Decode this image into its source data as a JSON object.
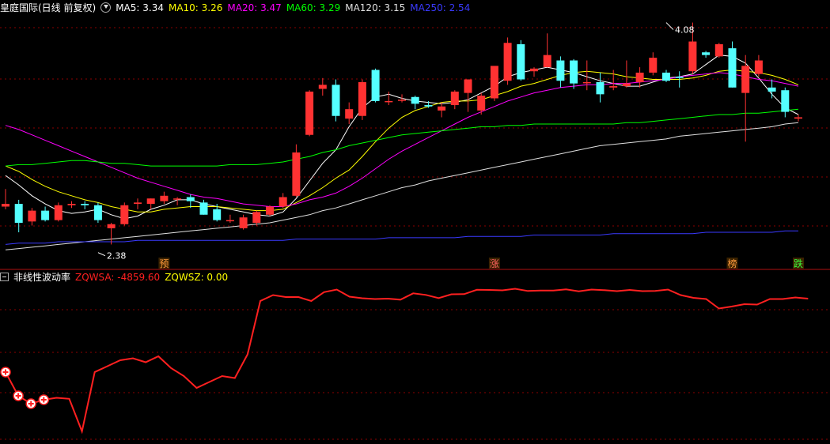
{
  "header": {
    "title": "皇庭国际(日线 前复权)",
    "ma": [
      {
        "label": "MA5: 3.34",
        "color": "#ffffff"
      },
      {
        "label": "MA10: 3.26",
        "color": "#ffff00"
      },
      {
        "label": "MA20: 3.47",
        "color": "#ff00ff"
      },
      {
        "label": "MA60: 3.29",
        "color": "#00ff00"
      },
      {
        "label": "MA120: 3.15",
        "color": "#e0e0e0"
      },
      {
        "label": "MA250: 2.54",
        "color": "#3a3aff"
      }
    ]
  },
  "indicator_header": {
    "name": "非线性波动率",
    "items": [
      {
        "label": "ZQWSA: -4859.60",
        "color": "#ff2020"
      },
      {
        "label": "ZQWSZ: 0.00",
        "color": "#ffff00"
      }
    ]
  },
  "colors": {
    "up": "#ff3232",
    "down": "#54ffff",
    "grid": "#8b0000",
    "bg": "#000000"
  },
  "chart_data": [
    {
      "type": "candlestick",
      "ylim": [
        2.32,
        4.13
      ],
      "grid": true,
      "annotations": [
        {
          "text": "4.08",
          "x": 50,
          "value": 4.08
        },
        {
          "text": "2.38",
          "x": 7,
          "value": 2.38
        }
      ],
      "event_markers": [
        {
          "text": "预",
          "x": 12,
          "color": "#ff9a3c"
        },
        {
          "text": "涨",
          "x": 37,
          "color": "#ff6060"
        },
        {
          "text": "榜",
          "x": 55,
          "color": "#ff9a3c"
        },
        {
          "text": "跌",
          "x": 60,
          "color": "#3cff3c"
        }
      ],
      "ohlc": [
        [
          2.72,
          2.85,
          2.7,
          2.74
        ],
        [
          2.74,
          2.77,
          2.53,
          2.6
        ],
        [
          2.61,
          2.71,
          2.58,
          2.69
        ],
        [
          2.69,
          2.72,
          2.61,
          2.62
        ],
        [
          2.62,
          2.75,
          2.61,
          2.73
        ],
        [
          2.73,
          2.76,
          2.71,
          2.74
        ],
        [
          2.74,
          2.76,
          2.7,
          2.73
        ],
        [
          2.73,
          2.75,
          2.6,
          2.62
        ],
        [
          2.56,
          2.6,
          2.44,
          2.59
        ],
        [
          2.59,
          2.75,
          2.58,
          2.73
        ],
        [
          2.74,
          2.78,
          2.7,
          2.75
        ],
        [
          2.74,
          2.78,
          2.7,
          2.78
        ],
        [
          2.76,
          2.83,
          2.74,
          2.8
        ],
        [
          2.78,
          2.79,
          2.73,
          2.78
        ],
        [
          2.79,
          2.81,
          2.71,
          2.76
        ],
        [
          2.75,
          2.77,
          2.66,
          2.66
        ],
        [
          2.7,
          2.74,
          2.61,
          2.62
        ],
        [
          2.62,
          2.66,
          2.6,
          2.62
        ],
        [
          2.56,
          2.66,
          2.55,
          2.64
        ],
        [
          2.6,
          2.69,
          2.58,
          2.68
        ],
        [
          2.66,
          2.73,
          2.65,
          2.72
        ],
        [
          2.72,
          2.82,
          2.71,
          2.79
        ],
        [
          2.8,
          3.18,
          2.79,
          3.12
        ],
        [
          3.25,
          3.58,
          3.24,
          3.57
        ],
        [
          3.59,
          3.67,
          3.54,
          3.62
        ],
        [
          3.62,
          3.66,
          3.35,
          3.39
        ],
        [
          3.37,
          3.49,
          3.33,
          3.44
        ],
        [
          3.39,
          3.66,
          3.36,
          3.64
        ],
        [
          3.73,
          3.74,
          3.49,
          3.5
        ],
        [
          3.5,
          3.57,
          3.47,
          3.5
        ],
        [
          3.51,
          3.55,
          3.49,
          3.51
        ],
        [
          3.53,
          3.54,
          3.44,
          3.48
        ],
        [
          3.47,
          3.5,
          3.45,
          3.46
        ],
        [
          3.43,
          3.49,
          3.38,
          3.46
        ],
        [
          3.47,
          3.58,
          3.44,
          3.57
        ],
        [
          3.56,
          3.65,
          3.42,
          3.66
        ],
        [
          3.43,
          3.56,
          3.4,
          3.54
        ],
        [
          3.52,
          3.74,
          3.5,
          3.76
        ],
        [
          3.65,
          3.97,
          3.62,
          3.93
        ],
        [
          3.92,
          3.95,
          3.65,
          3.66
        ],
        [
          3.72,
          3.75,
          3.68,
          3.74
        ],
        [
          3.75,
          4.0,
          3.75,
          3.84
        ],
        [
          3.8,
          3.83,
          3.6,
          3.65
        ],
        [
          3.8,
          3.81,
          3.59,
          3.63
        ],
        [
          3.64,
          3.8,
          3.58,
          3.64
        ],
        [
          3.64,
          3.71,
          3.49,
          3.55
        ],
        [
          3.6,
          3.73,
          3.58,
          3.61
        ],
        [
          3.61,
          3.8,
          3.6,
          3.63
        ],
        [
          3.64,
          3.75,
          3.6,
          3.71
        ],
        [
          3.71,
          3.86,
          3.69,
          3.82
        ],
        [
          3.71,
          3.73,
          3.64,
          3.65
        ],
        [
          3.68,
          3.72,
          3.6,
          3.67
        ],
        [
          3.72,
          4.08,
          3.7,
          3.94
        ],
        [
          3.86,
          3.87,
          3.82,
          3.84
        ],
        [
          3.83,
          3.93,
          3.82,
          3.92
        ],
        [
          3.89,
          3.94,
          3.6,
          3.6
        ],
        [
          3.56,
          3.84,
          3.2,
          3.76
        ],
        [
          3.7,
          3.84,
          3.68,
          3.8
        ],
        [
          3.6,
          3.66,
          3.52,
          3.57
        ],
        [
          3.58,
          3.6,
          3.38,
          3.42
        ],
        [
          3.37,
          3.4,
          3.35,
          3.38
        ]
      ],
      "ma_lines": {
        "MA5": [
          2.95,
          2.88,
          2.8,
          2.74,
          2.69,
          2.67,
          2.68,
          2.7,
          2.66,
          2.63,
          2.65,
          2.7,
          2.73,
          2.77,
          2.77,
          2.74,
          2.72,
          2.7,
          2.68,
          2.66,
          2.65,
          2.68,
          2.78,
          2.91,
          3.04,
          3.14,
          3.31,
          3.45,
          3.53,
          3.55,
          3.52,
          3.5,
          3.49,
          3.48,
          3.49,
          3.51,
          3.56,
          3.61,
          3.68,
          3.71,
          3.73,
          3.75,
          3.73,
          3.71,
          3.68,
          3.65,
          3.63,
          3.61,
          3.61,
          3.64,
          3.67,
          3.68,
          3.7,
          3.77,
          3.84,
          3.83,
          3.78,
          3.67,
          3.55,
          3.45,
          3.4
        ],
        "MA10": [
          3.02,
          2.98,
          2.92,
          2.87,
          2.83,
          2.8,
          2.77,
          2.75,
          2.72,
          2.7,
          2.68,
          2.68,
          2.7,
          2.71,
          2.72,
          2.72,
          2.72,
          2.71,
          2.7,
          2.69,
          2.69,
          2.7,
          2.75,
          2.8,
          2.86,
          2.93,
          2.99,
          3.09,
          3.2,
          3.3,
          3.38,
          3.43,
          3.46,
          3.49,
          3.5,
          3.5,
          3.51,
          3.54,
          3.57,
          3.61,
          3.63,
          3.66,
          3.69,
          3.71,
          3.72,
          3.71,
          3.7,
          3.68,
          3.67,
          3.66,
          3.66,
          3.66,
          3.67,
          3.69,
          3.72,
          3.73,
          3.72,
          3.71,
          3.69,
          3.66,
          3.62
        ],
        "MA20": [
          3.32,
          3.29,
          3.25,
          3.21,
          3.17,
          3.13,
          3.09,
          3.05,
          3.01,
          2.97,
          2.93,
          2.9,
          2.87,
          2.84,
          2.81,
          2.79,
          2.78,
          2.76,
          2.74,
          2.73,
          2.72,
          2.72,
          2.74,
          2.77,
          2.79,
          2.82,
          2.87,
          2.93,
          3.0,
          3.07,
          3.13,
          3.18,
          3.23,
          3.28,
          3.33,
          3.38,
          3.42,
          3.46,
          3.5,
          3.53,
          3.56,
          3.58,
          3.6,
          3.61,
          3.62,
          3.62,
          3.63,
          3.63,
          3.64,
          3.65,
          3.66,
          3.68,
          3.69,
          3.7,
          3.71,
          3.7,
          3.68,
          3.66,
          3.65,
          3.63,
          3.61
        ],
        "MA60": [
          3.02,
          3.03,
          3.03,
          3.04,
          3.05,
          3.06,
          3.06,
          3.05,
          3.04,
          3.04,
          3.03,
          3.02,
          3.02,
          3.02,
          3.02,
          3.02,
          3.02,
          3.03,
          3.03,
          3.03,
          3.04,
          3.05,
          3.07,
          3.09,
          3.12,
          3.14,
          3.17,
          3.19,
          3.21,
          3.23,
          3.25,
          3.26,
          3.27,
          3.28,
          3.29,
          3.3,
          3.31,
          3.31,
          3.32,
          3.32,
          3.33,
          3.33,
          3.33,
          3.33,
          3.33,
          3.33,
          3.33,
          3.34,
          3.34,
          3.35,
          3.36,
          3.37,
          3.38,
          3.39,
          3.4,
          3.4,
          3.41,
          3.41,
          3.42,
          3.43,
          3.44
        ],
        "MA120": [
          2.4,
          2.41,
          2.42,
          2.43,
          2.44,
          2.45,
          2.46,
          2.47,
          2.48,
          2.49,
          2.5,
          2.51,
          2.52,
          2.53,
          2.54,
          2.55,
          2.56,
          2.57,
          2.58,
          2.59,
          2.6,
          2.62,
          2.64,
          2.66,
          2.69,
          2.71,
          2.74,
          2.77,
          2.8,
          2.83,
          2.86,
          2.88,
          2.91,
          2.93,
          2.95,
          2.97,
          2.99,
          3.01,
          3.03,
          3.05,
          3.07,
          3.09,
          3.11,
          3.13,
          3.15,
          3.17,
          3.18,
          3.19,
          3.2,
          3.21,
          3.22,
          3.24,
          3.25,
          3.26,
          3.27,
          3.28,
          3.29,
          3.3,
          3.31,
          3.33,
          3.34
        ],
        "MA250": [
          2.44,
          2.45,
          2.45,
          2.45,
          2.46,
          2.46,
          2.46,
          2.46,
          2.46,
          2.46,
          2.47,
          2.47,
          2.47,
          2.47,
          2.47,
          2.47,
          2.47,
          2.47,
          2.47,
          2.47,
          2.47,
          2.47,
          2.48,
          2.48,
          2.48,
          2.48,
          2.48,
          2.48,
          2.48,
          2.49,
          2.49,
          2.49,
          2.49,
          2.49,
          2.49,
          2.5,
          2.5,
          2.5,
          2.5,
          2.5,
          2.51,
          2.51,
          2.51,
          2.51,
          2.51,
          2.51,
          2.52,
          2.52,
          2.52,
          2.52,
          2.52,
          2.52,
          2.52,
          2.53,
          2.53,
          2.53,
          2.53,
          2.53,
          2.53,
          2.54,
          2.54
        ]
      }
    },
    {
      "type": "line",
      "series": [
        {
          "name": "ZQWSA",
          "color": "#ff2020",
          "values": [
            -9600,
            -10800,
            -11200,
            -11000,
            -10900,
            -10950,
            -12600,
            -9600,
            -9300,
            -9000,
            -8900,
            -9100,
            -8800,
            -9400,
            -9800,
            -10400,
            -10100,
            -9800,
            -9900,
            -8700,
            -6000,
            -5700,
            -5800,
            -5800,
            -6000,
            -5550,
            -5420,
            -5780,
            -5860,
            -5900,
            -5880,
            -5930,
            -5610,
            -5690,
            -5850,
            -5660,
            -5650,
            -5430,
            -5440,
            -5460,
            -5380,
            -5490,
            -5470,
            -5470,
            -5410,
            -5510,
            -5420,
            -5450,
            -5500,
            -5440,
            -5500,
            -5490,
            -5420,
            -5700,
            -5840,
            -5900,
            -6380,
            -6280,
            -6160,
            -6180,
            -5900,
            -5900,
            -5820,
            -5880
          ]
        }
      ],
      "markers": [
        0,
        1,
        2,
        3
      ],
      "ylim": [
        -13000,
        -5000
      ],
      "grid": true
    }
  ]
}
